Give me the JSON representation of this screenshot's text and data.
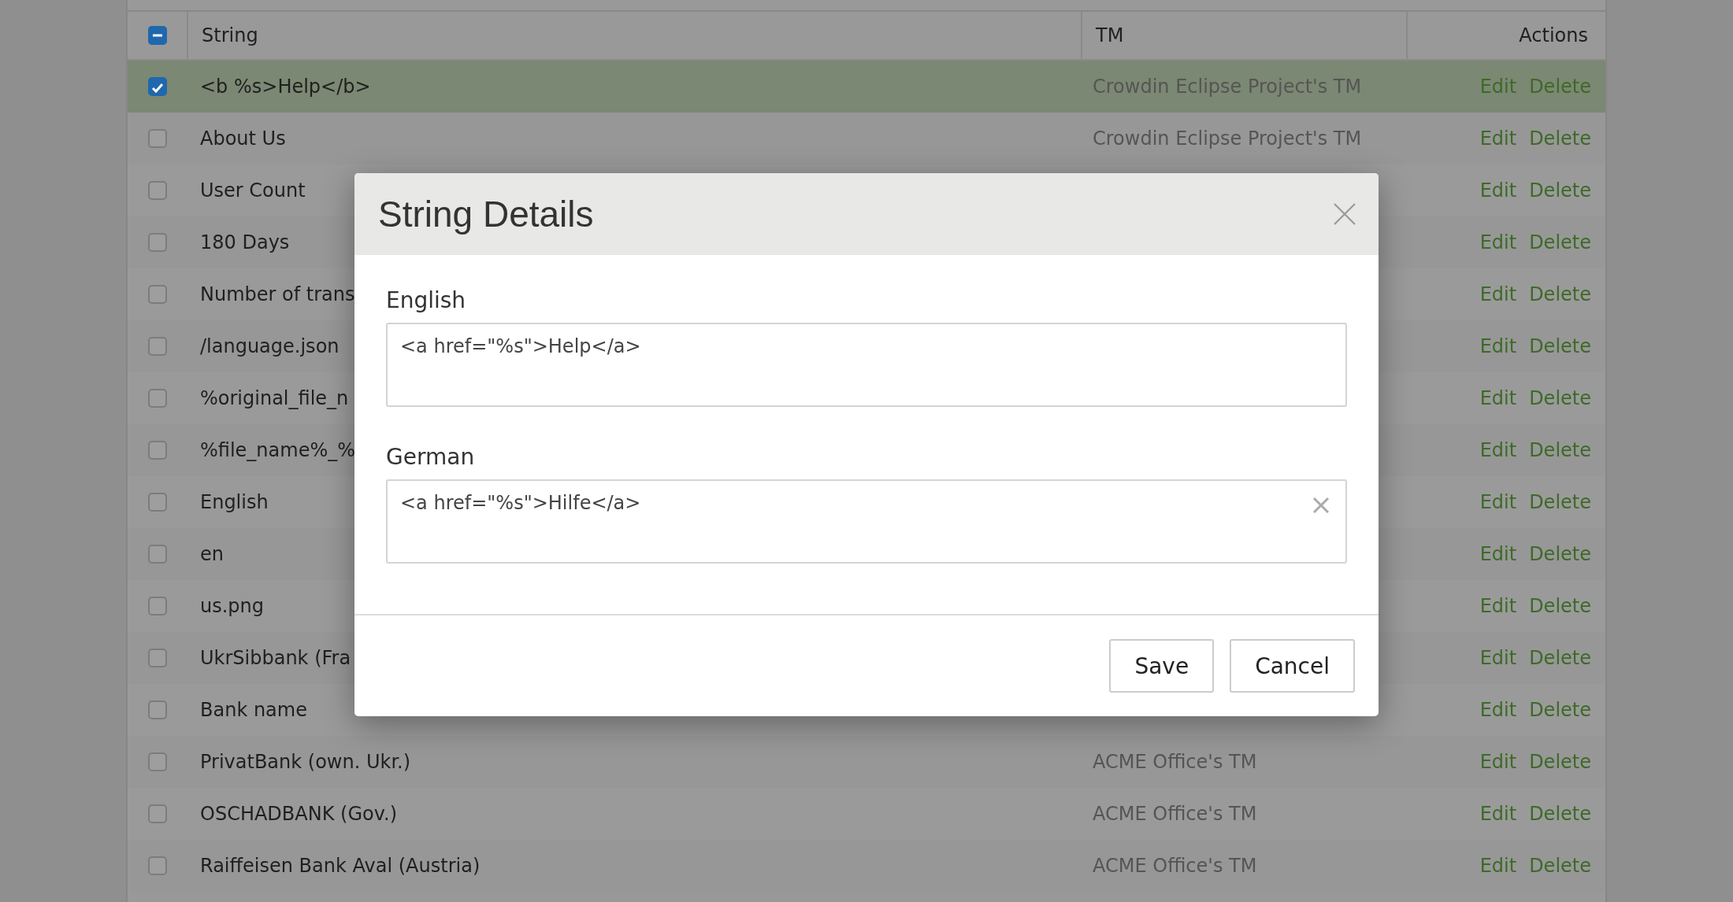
{
  "table": {
    "header_checkbox": {
      "kind": "indeterminate"
    },
    "columns": [
      "String",
      "TM",
      "Actions"
    ],
    "rows": [
      {
        "string": "<b %s>Help</b>",
        "tm": "Crowdin Eclipse Project's TM",
        "checked": true,
        "selected": true,
        "actions": [
          "Edit",
          "Delete"
        ]
      },
      {
        "string": "About Us",
        "tm": "Crowdin Eclipse Project's TM",
        "checked": false,
        "selected": false,
        "actions": [
          "Edit",
          "Delete"
        ]
      },
      {
        "string": "User Count",
        "checked": false,
        "selected": false,
        "actions": [
          "Edit",
          "Delete"
        ]
      },
      {
        "string": "180 Days",
        "checked": false,
        "selected": false,
        "actions": [
          "Edit",
          "Delete"
        ]
      },
      {
        "string": "Number of trans",
        "checked": false,
        "selected": false,
        "actions": [
          "Edit",
          "Delete"
        ]
      },
      {
        "string": "/language.json",
        "checked": false,
        "selected": false,
        "actions": [
          "Edit",
          "Delete"
        ]
      },
      {
        "string": "%original_file_n",
        "checked": false,
        "selected": false,
        "actions": [
          "Edit",
          "Delete"
        ]
      },
      {
        "string": "%file_name%_%",
        "checked": false,
        "selected": false,
        "actions": [
          "Edit",
          "Delete"
        ]
      },
      {
        "string": "English",
        "checked": false,
        "selected": false,
        "actions": [
          "Edit",
          "Delete"
        ]
      },
      {
        "string": "en",
        "checked": false,
        "selected": false,
        "actions": [
          "Edit",
          "Delete"
        ]
      },
      {
        "string": "us.png",
        "checked": false,
        "selected": false,
        "actions": [
          "Edit",
          "Delete"
        ]
      },
      {
        "string": "UkrSibbank (Fra",
        "checked": false,
        "selected": false,
        "actions": [
          "Edit",
          "Delete"
        ]
      },
      {
        "string": "Bank name",
        "checked": false,
        "selected": false,
        "actions": [
          "Edit",
          "Delete"
        ]
      },
      {
        "string": "PrivatBank (own. Ukr.)",
        "tm": "ACME Office's TM",
        "checked": false,
        "selected": false,
        "actions": [
          "Edit",
          "Delete"
        ]
      },
      {
        "string": "OSCHADBANK (Gov.)",
        "tm": "ACME Office's TM",
        "checked": false,
        "selected": false,
        "actions": [
          "Edit",
          "Delete"
        ]
      },
      {
        "string": "Raiffeisen Bank Aval (Austria)",
        "tm": "ACME Office's TM",
        "checked": false,
        "selected": false,
        "actions": [
          "Edit",
          "Delete"
        ]
      }
    ]
  },
  "dialog": {
    "title": "String Details",
    "fields": [
      {
        "label": "English",
        "value": "<a href=\"%s\">Help</a>",
        "clearable": false
      },
      {
        "label": "German",
        "value": "<a href=\"%s\">Hilfe</a>",
        "clearable": true
      }
    ],
    "buttons": [
      "Save",
      "Cancel"
    ]
  }
}
